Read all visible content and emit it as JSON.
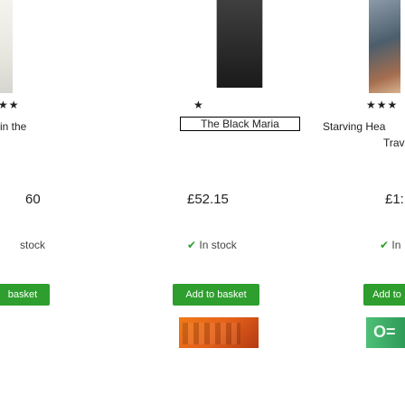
{
  "products": [
    {
      "rating": "★★",
      "title": "in the",
      "price": "60",
      "stock": "stock",
      "button_label": "basket"
    },
    {
      "rating": "★",
      "title": "The Black Maria",
      "price": "£52.15",
      "stock_icon": "✔",
      "stock": "In stock",
      "button_label": "Add to basket"
    },
    {
      "rating": "★★★",
      "title": "Starving Hea",
      "subtitle": "Trav",
      "price": "£1:",
      "stock_icon": "✔",
      "stock": "In",
      "button_label": "Add to"
    }
  ],
  "colors": {
    "button": "#2e9e2e",
    "in_stock": "#2e9e2e"
  },
  "banner_right_text": "O="
}
